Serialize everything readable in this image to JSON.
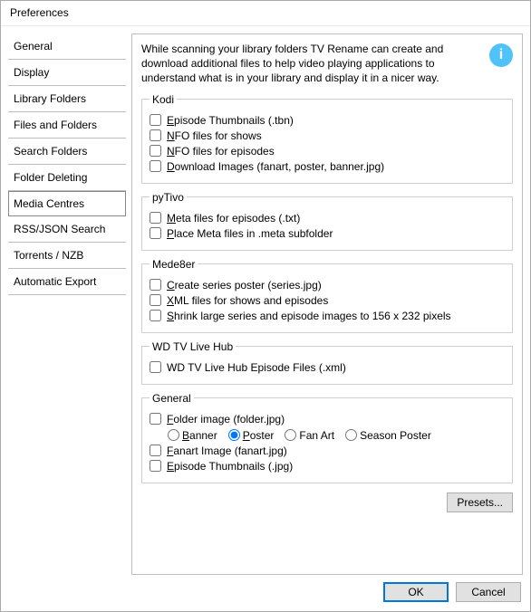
{
  "window": {
    "title": "Preferences"
  },
  "sidebar": {
    "items": [
      {
        "label": "General"
      },
      {
        "label": "Display"
      },
      {
        "label": "Library Folders"
      },
      {
        "label": "Files and Folders"
      },
      {
        "label": "Search Folders"
      },
      {
        "label": "Folder Deleting"
      },
      {
        "label": "Media Centres"
      },
      {
        "label": "RSS/JSON Search"
      },
      {
        "label": "Torrents / NZB"
      },
      {
        "label": "Automatic Export"
      }
    ],
    "selected_index": 6
  },
  "description": "While scanning your library folders TV Rename can create and download additional files to help video playing applications to understand what is in your library and display it in a nicer way.",
  "info_icon_glyph": "i",
  "groups": {
    "kodi": {
      "legend": "Kodi",
      "items": [
        {
          "label": "Episode Thumbnails (.tbn)"
        },
        {
          "label": "NFO files for shows"
        },
        {
          "label": "NFO files for episodes"
        },
        {
          "label": "Download Images (fanart, poster, banner.jpg)"
        }
      ]
    },
    "pytivo": {
      "legend": "pyTivo",
      "items": [
        {
          "label": "Meta files for episodes (.txt)"
        },
        {
          "label": "Place Meta files in .meta subfolder"
        }
      ]
    },
    "mede8er": {
      "legend": "Mede8er",
      "items": [
        {
          "label": "Create series poster (series.jpg)"
        },
        {
          "label": "XML files for shows and episodes"
        },
        {
          "label": "Shrink large series and episode images to 156 x 232 pixels"
        }
      ]
    },
    "wdtv": {
      "legend": "WD TV Live Hub",
      "items": [
        {
          "label": "WD TV Live Hub Episode Files (.xml)"
        }
      ]
    },
    "general": {
      "legend": "General",
      "folder_image": {
        "label": "Folder image (folder.jpg)"
      },
      "folder_image_options": [
        {
          "label": "Banner"
        },
        {
          "label": "Poster"
        },
        {
          "label": "Fan Art"
        },
        {
          "label": "Season Poster"
        }
      ],
      "folder_image_selected_index": 1,
      "fanart": {
        "label": "Fanart Image (fanart.jpg)"
      },
      "ep_thumbs": {
        "label": "Episode Thumbnails (.jpg)"
      }
    }
  },
  "buttons": {
    "presets": "Presets...",
    "ok": "OK",
    "cancel": "Cancel"
  }
}
